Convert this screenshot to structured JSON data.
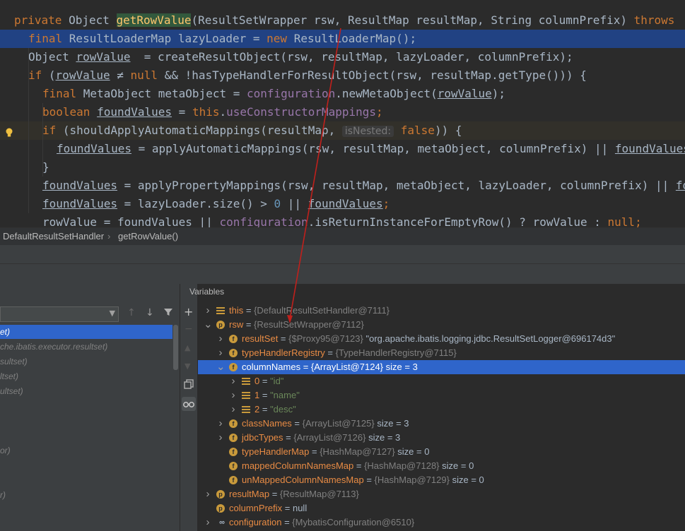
{
  "editor": {
    "lines": [
      {
        "parts": [
          [
            "kw",
            "private "
          ],
          [
            "",
            "Object "
          ],
          [
            "fnhl",
            "getRowValue"
          ],
          [
            "",
            "(ResultSetWrapper rsw, ResultMap resultMap, String columnPrefix) "
          ],
          [
            "kw",
            "throws"
          ]
        ],
        "indent": 20
      },
      {
        "parts": [
          [
            "kw",
            "final "
          ],
          [
            "",
            "ResultLoaderMap lazyLoader = "
          ],
          [
            "kw",
            "new "
          ],
          [
            "",
            "ResultLoaderMap();"
          ]
        ],
        "indent": 40,
        "highlight": true
      },
      {
        "parts": [
          [
            "",
            "Object "
          ],
          [
            "ul",
            "rowValue"
          ],
          [
            "",
            "  = createResultObject(rsw, resultMap, lazyLoader, columnPrefix);"
          ]
        ],
        "indent": 40
      },
      {
        "parts": [
          [
            "kw",
            "if "
          ],
          [
            "",
            "("
          ],
          [
            "ul",
            "rowValue"
          ],
          [
            "",
            " ≠ "
          ],
          [
            "kw",
            "null "
          ],
          [
            "",
            "&& !hasTypeHandlerForResultObject(rsw, resultMap.getType())) {"
          ]
        ],
        "indent": 40
      },
      {
        "parts": [
          [
            "kw",
            "final "
          ],
          [
            "",
            "MetaObject metaObject = "
          ],
          [
            "fl",
            "configuration"
          ],
          [
            "",
            ".newMetaObject("
          ],
          [
            "ul",
            "rowValue"
          ],
          [
            "",
            ");"
          ]
        ],
        "indent": 60
      },
      {
        "parts": [
          [
            "kw",
            "boolean "
          ],
          [
            "ul",
            "foundValues"
          ],
          [
            "",
            " = "
          ],
          [
            "kw",
            "this"
          ],
          [
            "",
            "."
          ],
          [
            "fl",
            "useConstructorMappings"
          ],
          [
            "kw",
            ";"
          ]
        ],
        "indent": 60
      },
      {
        "parts": [
          [
            "kw",
            "if "
          ],
          [
            "",
            "(shouldApplyAutomaticMappings(resultMap, "
          ],
          [
            "hint",
            "isNested:"
          ],
          [
            "kw",
            " false"
          ],
          [
            "",
            "))"
          ],
          [
            "",
            " {"
          ]
        ],
        "indent": 60,
        "warn": true
      },
      {
        "parts": [
          [
            "ul",
            "foundValues"
          ],
          [
            "",
            " = applyAutomaticMappings(rsw, resultMap, metaObject, columnPrefix) || "
          ],
          [
            "ul",
            "foundValues"
          ],
          [
            "",
            ";"
          ]
        ],
        "indent": 80
      },
      {
        "parts": [
          [
            "",
            "}"
          ]
        ],
        "indent": 60
      },
      {
        "parts": [
          [
            "ul",
            "foundValues"
          ],
          [
            "",
            " = applyPropertyMappings(rsw, resultMap, metaObject, lazyLoader, columnPrefix) || "
          ],
          [
            "ul",
            "foundValues"
          ],
          [
            "",
            ";"
          ]
        ],
        "indent": 60
      },
      {
        "parts": [
          [
            "ul",
            "foundValues"
          ],
          [
            "",
            " = lazyLoader.size() > "
          ],
          [
            "nm",
            "0"
          ],
          [
            "",
            " || "
          ],
          [
            "ul",
            "foundValues"
          ],
          [
            "kw",
            ";"
          ]
        ],
        "indent": 60
      },
      {
        "parts": [
          [
            "",
            "rowValue = foundValues || "
          ],
          [
            "fl",
            "configuration"
          ],
          [
            "",
            ".isReturnInstanceForEmptyRow() ? rowValue : "
          ],
          [
            "kw",
            "null"
          ],
          [
            "kw",
            ";"
          ]
        ],
        "indent": 60
      }
    ]
  },
  "breadcrumb": {
    "class_name": "DefaultResultSetHandler",
    "method_name": "getRowValue()"
  },
  "variables_title": "Variables",
  "frames": [
    {
      "text": "et)",
      "selected": true
    },
    {
      "text": "che.ibatis.executor.resultset)",
      "selected": false
    },
    {
      "text": "sultset)",
      "selected": false
    },
    {
      "text": "ltset)",
      "selected": false
    },
    {
      "text": "ultset)",
      "selected": false
    },
    {
      "text": "",
      "selected": false
    },
    {
      "text": "",
      "selected": false
    },
    {
      "text": "",
      "selected": false
    },
    {
      "text": "or)",
      "selected": false
    },
    {
      "text": "",
      "selected": false
    },
    {
      "text": "",
      "selected": false
    },
    {
      "text": "r)",
      "selected": false
    },
    {
      "text": "",
      "selected": false
    }
  ],
  "variables": [
    {
      "depth": 0,
      "arrow": "collapsed",
      "icon": "list",
      "name": "this",
      "ref": "{DefaultResultSetHandler@7111}",
      "value": "",
      "extra": ""
    },
    {
      "depth": 0,
      "arrow": "expanded",
      "icon": "p",
      "name": "rsw",
      "ref": "{ResultSetWrapper@7112}",
      "value": "",
      "extra": ""
    },
    {
      "depth": 1,
      "arrow": "collapsed",
      "icon": "f",
      "name": "resultSet",
      "ref": "{$Proxy95@7123}",
      "value": "\"org.apache.ibatis.logging.jdbc.ResultSetLogger@696174d3\"",
      "extra": ""
    },
    {
      "depth": 1,
      "arrow": "collapsed",
      "icon": "f",
      "name": "typeHandlerRegistry",
      "ref": "{TypeHandlerRegistry@7115}",
      "value": "",
      "extra": ""
    },
    {
      "depth": 1,
      "arrow": "expanded",
      "icon": "f",
      "name": "columnNames",
      "ref": "{ArrayList@7124}",
      "value": "",
      "extra": "size = 3",
      "selected": true
    },
    {
      "depth": 2,
      "arrow": "collapsed",
      "icon": "list",
      "name": "0",
      "ref": "",
      "value": "\"id\"",
      "extra": ""
    },
    {
      "depth": 2,
      "arrow": "collapsed",
      "icon": "list",
      "name": "1",
      "ref": "",
      "value": "\"name\"",
      "extra": ""
    },
    {
      "depth": 2,
      "arrow": "collapsed",
      "icon": "list",
      "name": "2",
      "ref": "",
      "value": "\"desc\"",
      "extra": ""
    },
    {
      "depth": 1,
      "arrow": "collapsed",
      "icon": "f",
      "name": "classNames",
      "ref": "{ArrayList@7125}",
      "value": "",
      "extra": "size = 3"
    },
    {
      "depth": 1,
      "arrow": "collapsed",
      "icon": "f",
      "name": "jdbcTypes",
      "ref": "{ArrayList@7126}",
      "value": "",
      "extra": "size = 3"
    },
    {
      "depth": 1,
      "arrow": "none",
      "icon": "f",
      "name": "typeHandlerMap",
      "ref": "{HashMap@7127}",
      "value": "",
      "extra": "size = 0"
    },
    {
      "depth": 1,
      "arrow": "none",
      "icon": "f",
      "name": "mappedColumnNamesMap",
      "ref": "{HashMap@7128}",
      "value": "",
      "extra": "size = 0"
    },
    {
      "depth": 1,
      "arrow": "none",
      "icon": "f",
      "name": "unMappedColumnNamesMap",
      "ref": "{HashMap@7129}",
      "value": "",
      "extra": "size = 0"
    },
    {
      "depth": 0,
      "arrow": "collapsed",
      "icon": "p",
      "name": "resultMap",
      "ref": "{ResultMap@7113}",
      "value": "",
      "extra": ""
    },
    {
      "depth": 0,
      "arrow": "none",
      "icon": "p",
      "name": "columnPrefix",
      "ref": "",
      "value": "null",
      "extra": ""
    },
    {
      "depth": 0,
      "arrow": "collapsed",
      "icon": "oo",
      "name": "configuration",
      "ref": "{MybatisConfiguration@6510}",
      "value": "",
      "extra": ""
    }
  ],
  "colors": {
    "selection": "#2f65ca",
    "editor_bg": "#2b2b2b",
    "keyword": "#cc7832",
    "field": "#9876aa",
    "method": "#ffc66d",
    "string": "#6a8759"
  }
}
